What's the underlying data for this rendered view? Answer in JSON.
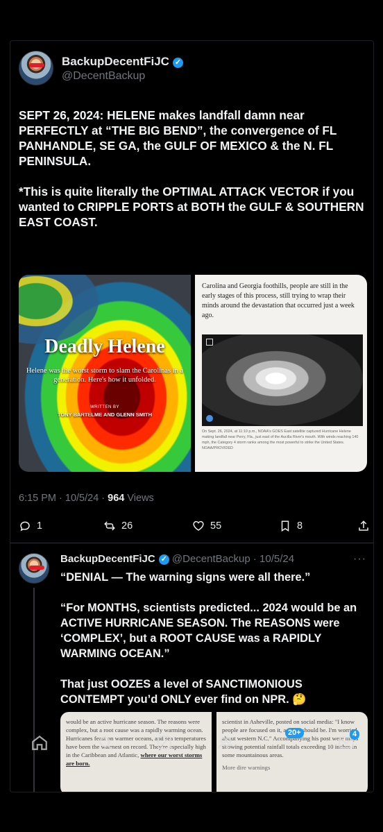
{
  "post1": {
    "author_name": "BackupDecentFiJC",
    "author_handle": "@DecentBackup",
    "text": "SEPT 26, 2024: HELENE makes landfall damn near PERFECTLY at “THE BIG BEND”, the convergence of FL PANHANDLE, SE GA, the GULF OF MEXICO & the N. FL PENINSULA.\n\n*This is quite literally the OPTIMAL ATTACK VECTOR if you wanted to CRIPPLE PORTS at BOTH the GULF & SOUTHERN EAST COAST.",
    "media_left": {
      "title": "Deadly Helene",
      "subtitle": "Helene was the worst storm to slam the Carolinas in a generation. Here's how it unfolded.",
      "written_by": "WRITTEN BY",
      "byline": "TONY BARTELME AND GLENN SMITH"
    },
    "media_right": {
      "text": "Carolina and Georgia foothills, people are still in the early stages of this process, still trying to wrap their minds around the devastation that occurred just a week ago.",
      "caption": "On Sept. 26, 2024, at 11:10 p.m., NOAA's GOES East satellite captured Hurricane Helene making landfall near Perry, Fla., just east of the Aucilla River's mouth. With winds reaching 140 mph, the Category 4 storm ranks among the most powerful to strike the United States. NOAA/PROVIDED"
    },
    "time": "6:15 PM · 10/5/24 · ",
    "views_count": "964",
    "views_label": " Views",
    "replies": "1",
    "reposts": "26",
    "likes": "55",
    "bookmarks": "8"
  },
  "post2": {
    "author_name": "BackupDecentFiJC",
    "handle_date": "@DecentBackup · 10/5/24",
    "more": "···",
    "text": "“DENIAL — The warning signs were all there.”\n\n“For MONTHS, scientists predicted... 2024 would be an ACTIVE HURRICANE SEASON. The REASONS were ‘COMPLEX’, but a ROOT CAUSE was a RAPIDLY WARMING OCEAN.”\n\nThat just OOZES a level of SANCTIMONIOUS CONTEMPT you’d ONLY ever find on NPR. 🤔",
    "media_left": {
      "text": "would be an active hurricane season. The reasons were complex, but a root cause was a rapidly warming ocean. Hurricanes feast on warmer oceans, and sea temperatures have been the warmest on record. They're especially high in the Caribbean and Atlantic,",
      "link": "where our worst storms are born."
    },
    "media_right": {
      "text": "scientist in Asheville, posted on social media: \"I know people are focused on it, as they should be. I'm worried about western N.C.\" Accompanying his post were maps showing potential rainfall totals exceeding 10 inches in some mountainous areas.",
      "more": "More dire warnings"
    }
  },
  "nav": {
    "badge_communities": "20+",
    "badge_messages": "4"
  },
  "colors": {
    "background": "#000000",
    "text": "#e7e9ea",
    "muted": "#71767b",
    "accent": "#1d9bf0"
  }
}
